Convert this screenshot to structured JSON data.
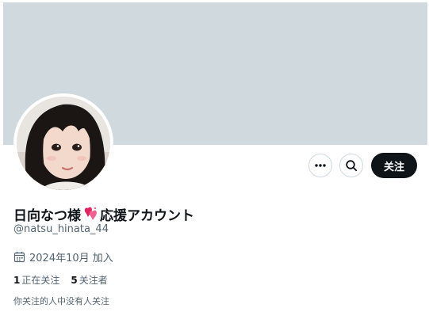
{
  "profile": {
    "display_name_part1": "日向なつ様",
    "display_name_part2": "応援アカウント",
    "handle": "@natsu_hinata_44",
    "joined": "2024年10月 加入",
    "following_count": "1",
    "following_label": "正在关注",
    "followers_count": "5",
    "followers_label": "关注者",
    "followers_you_know": "你关注的人中没有人关注"
  },
  "actions": {
    "more_icon": "more-horizontal-icon",
    "search_icon": "search-icon",
    "follow_label": "关注"
  },
  "icons": {
    "name_emoji": "two-hearts-icon",
    "joined_icon": "calendar-icon"
  },
  "colors": {
    "banner": "#cfd9de",
    "follow_button": "#0f1419",
    "secondary_text": "#536471",
    "heart": "#e0245e"
  }
}
